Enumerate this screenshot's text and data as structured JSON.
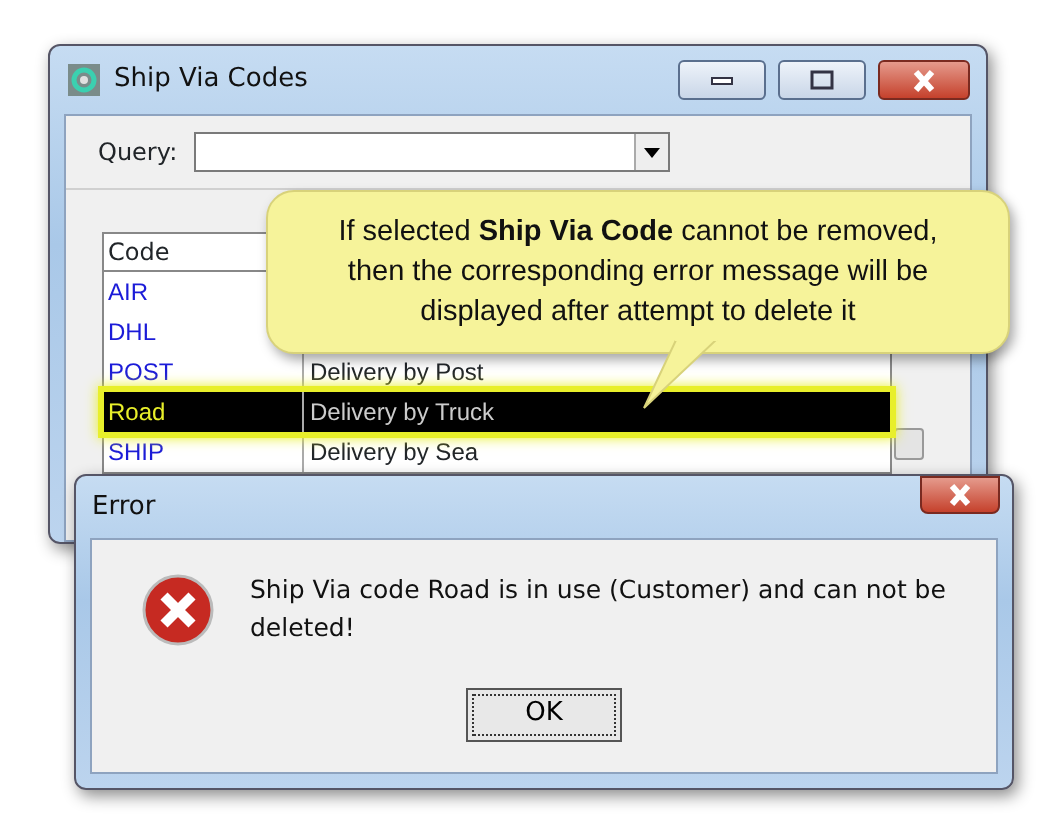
{
  "window": {
    "title": "Ship Via Codes"
  },
  "query": {
    "label": "Query:"
  },
  "table": {
    "columns": [
      "Code"
    ],
    "rows": [
      {
        "code": "AIR",
        "selected": false
      },
      {
        "code": "DHL",
        "selected": false
      },
      {
        "code": "POST",
        "description": "Delivery by Post",
        "selected": false
      },
      {
        "code": "Road",
        "description": "Delivery by Truck",
        "selected": true
      },
      {
        "code": "SHIP",
        "description": "Delivery by Sea",
        "selected": false
      }
    ]
  },
  "callout": {
    "text": "If selected **Ship Via Code** cannot be removed, then the corresponding error message will be displayed after attempt to delete it"
  },
  "error_dialog": {
    "title": "Error",
    "message": "Ship Via code Road is in use (Customer) and can not be deleted!",
    "button": "OK"
  }
}
